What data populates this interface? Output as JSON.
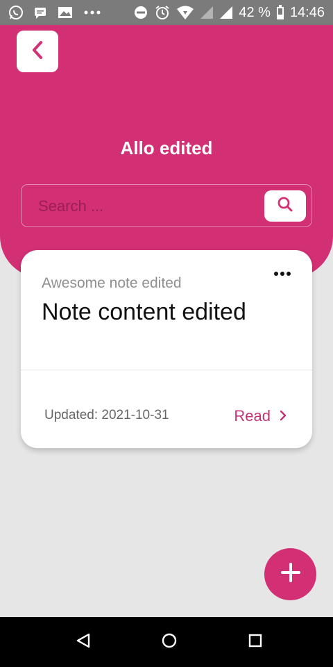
{
  "status_bar": {
    "battery_text": "42 %",
    "time": "14:46",
    "icons": [
      "whatsapp-icon",
      "message-icon",
      "picture-icon",
      "more-icon",
      "dnd-icon",
      "alarm-icon",
      "wifi-icon",
      "signal-icon",
      "signal-icon",
      "battery-icon"
    ]
  },
  "header": {
    "title": "Allo edited",
    "back_icon": "chevron-left-icon"
  },
  "search": {
    "placeholder": "Search ...",
    "value": "",
    "icon": "search-icon"
  },
  "note": {
    "subtitle": "Awesome note edited",
    "title": "Note content edited",
    "updated": "Updated: 2021-10-31",
    "read_label": "Read",
    "more_icon": "more-horizontal-icon"
  },
  "fab": {
    "icon": "plus-icon"
  },
  "nav": {
    "icons": [
      "back-triangle-icon",
      "home-circle-icon",
      "recents-square-icon"
    ]
  },
  "colors": {
    "accent": "#d22f74",
    "background": "#e6e6e6",
    "card": "#ffffff",
    "status_bar": "#7b7b7b",
    "nav_bar": "#000000"
  }
}
